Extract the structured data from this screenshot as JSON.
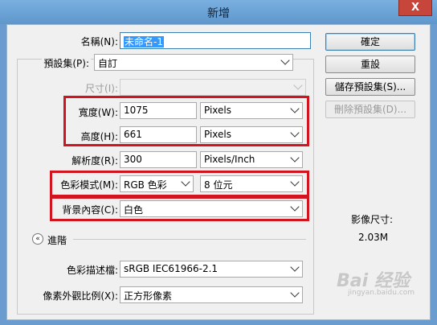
{
  "window": {
    "title": "新增",
    "close_glyph": "X"
  },
  "form": {
    "name": {
      "label": "名稱(N):",
      "value": "未命名-1"
    },
    "preset": {
      "label": "預設集(P):",
      "value": "自訂"
    },
    "size": {
      "label": "尺寸(I):",
      "value": ""
    },
    "width": {
      "label": "寬度(W):",
      "value": "1075",
      "unit": "Pixels"
    },
    "height": {
      "label": "高度(H):",
      "value": "661",
      "unit": "Pixels"
    },
    "resolution": {
      "label": "解析度(R):",
      "value": "300",
      "unit": "Pixels/Inch"
    },
    "color_mode": {
      "label": "色彩模式(M):",
      "mode": "RGB 色彩",
      "depth": "8 位元"
    },
    "background": {
      "label": "背景內容(C):",
      "value": "白色"
    },
    "advanced": {
      "label": "進階",
      "glyph": "«"
    },
    "color_profile": {
      "label": "色彩描述檔:",
      "value": "sRGB IEC61966-2.1"
    },
    "pixel_aspect": {
      "label": "像素外觀比例(X):",
      "value": "正方形像素"
    }
  },
  "buttons": {
    "ok": "確定",
    "reset": "重設",
    "save_preset": "儲存預設集(S)...",
    "delete_preset": "刪除預設集(D)..."
  },
  "image_size": {
    "label": "影像尺寸:",
    "value": "2.03M"
  },
  "watermark": {
    "text": "Bai 经验",
    "sub": "jingyan.baidu.com"
  },
  "colors": {
    "highlight": "#d2141e",
    "title_bar": "#6a9ccf",
    "close_button": "#c7463b"
  }
}
